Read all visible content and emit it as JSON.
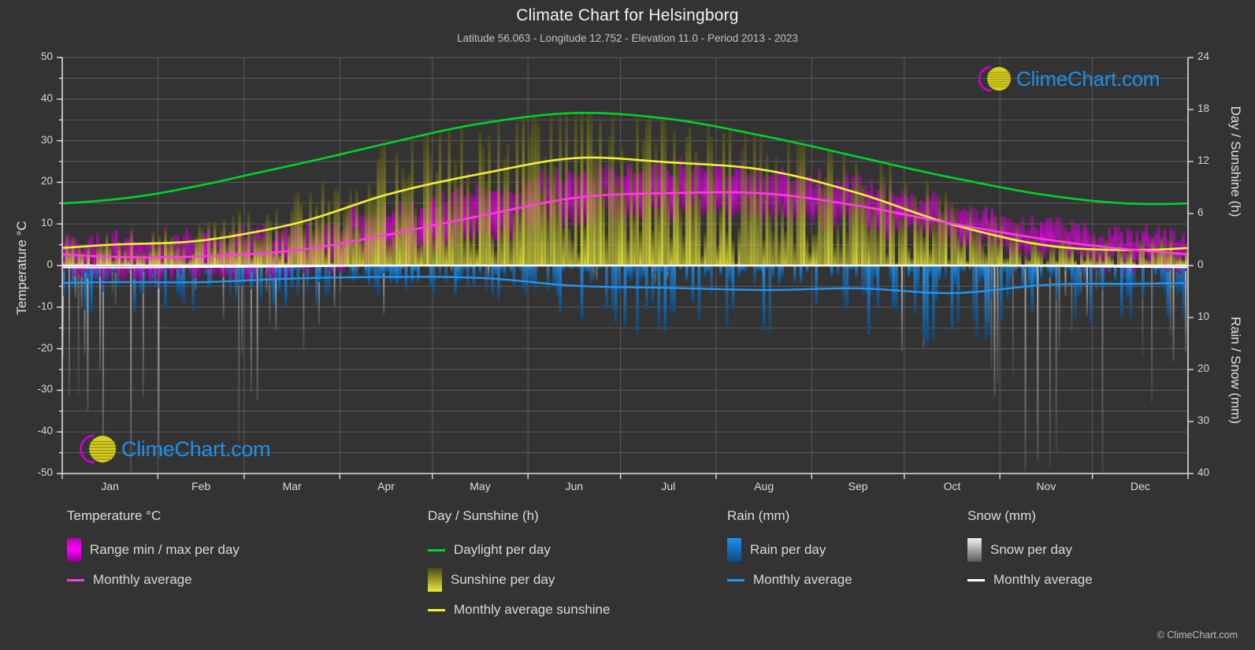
{
  "header": {
    "title": "Climate Chart for Helsingborg",
    "subtitle": "Latitude 56.063 - Longitude 12.752 - Elevation 11.0 - Period 2013 - 2023"
  },
  "branding": {
    "logo_text": "ClimeChart.com",
    "copyright": "© ClimeChart.com"
  },
  "axes": {
    "left_title": "Temperature °C",
    "right_top_title": "Day / Sunshine (h)",
    "right_bottom_title": "Rain / Snow (mm)",
    "left_ticks": [
      "50",
      "40",
      "30",
      "20",
      "10",
      "0",
      "-10",
      "-20",
      "-30",
      "-40",
      "-50"
    ],
    "right_top_ticks": [
      "24",
      "18",
      "12",
      "6",
      "0"
    ],
    "right_bottom_ticks": [
      "10",
      "20",
      "30",
      "40"
    ]
  },
  "legend": {
    "temperature": {
      "heading": "Temperature °C",
      "items": [
        {
          "label": "Range min / max per day",
          "type": "swatch",
          "color": "#ee00ee"
        },
        {
          "label": "Monthly average",
          "type": "line",
          "color": "#ff3ddd"
        }
      ]
    },
    "day_sunshine": {
      "heading": "Day / Sunshine (h)",
      "items": [
        {
          "label": "Daylight per day",
          "type": "line",
          "color": "#00d22a"
        },
        {
          "label": "Sunshine per day",
          "type": "swatch",
          "color": "#e8e830"
        },
        {
          "label": "Monthly average sunshine",
          "type": "line",
          "color": "#f0f03a"
        }
      ]
    },
    "rain": {
      "heading": "Rain (mm)",
      "items": [
        {
          "label": "Rain per day",
          "type": "swatch",
          "color": "#1e88e5"
        },
        {
          "label": "Monthly average",
          "type": "line",
          "color": "#2196f3"
        }
      ]
    },
    "snow": {
      "heading": "Snow (mm)",
      "items": [
        {
          "label": "Snow per day",
          "type": "swatch",
          "color": "#dcdcdc"
        },
        {
          "label": "Monthly average",
          "type": "line",
          "color": "#ffffff"
        }
      ]
    }
  },
  "chart_data": {
    "type": "line",
    "title": "Climate Chart for Helsingborg",
    "subtitle": "Latitude 56.063 - Longitude 12.752 - Elevation 11.0 - Period 2013 - 2023",
    "xlabel": "",
    "ylabel": "Temperature °C",
    "ylim": [
      -50,
      50
    ],
    "y2_top_label": "Day / Sunshine (h)",
    "y2_top_lim": [
      0,
      24
    ],
    "y2_bottom_label": "Rain / Snow (mm)",
    "y2_bottom_lim": [
      0,
      40
    ],
    "grid": true,
    "legend_position": "below",
    "categories": [
      "Jan",
      "Feb",
      "Mar",
      "Apr",
      "May",
      "Jun",
      "Jul",
      "Aug",
      "Sep",
      "Oct",
      "Nov",
      "Dec"
    ],
    "series": [
      {
        "name": "Daylight per day",
        "unit": "h",
        "color": "#00d22a",
        "values": [
          7.6,
          9.3,
          11.6,
          14.1,
          16.4,
          17.6,
          16.9,
          14.9,
          12.5,
          10.1,
          8.1,
          7.1
        ]
      },
      {
        "name": "Monthly average sunshine",
        "unit": "h",
        "color": "#f0f03a",
        "values": [
          2.4,
          2.9,
          4.8,
          8.2,
          10.6,
          12.4,
          11.9,
          11.0,
          8.3,
          4.7,
          2.3,
          1.8
        ]
      },
      {
        "name": "Monthly average temperature",
        "unit": "°C",
        "color": "#ff3ddd",
        "values": [
          2.1,
          2.2,
          3.6,
          7.4,
          12.0,
          16.3,
          17.4,
          17.3,
          14.3,
          10.0,
          6.2,
          3.6
        ]
      },
      {
        "name": "Monthly average rain",
        "unit": "mm",
        "color": "#2196f3",
        "values": [
          3.2,
          3.2,
          2.5,
          2.2,
          2.4,
          3.9,
          4.3,
          4.7,
          4.4,
          5.3,
          3.7,
          3.5
        ]
      },
      {
        "name": "Monthly average snow",
        "unit": "mm",
        "color": "#ffffff",
        "values": [
          0.4,
          0.3,
          0.2,
          0.0,
          0.0,
          0.0,
          0.0,
          0.0,
          0.0,
          0.0,
          0.1,
          0.3
        ]
      }
    ],
    "daily_ranges": {
      "name": "Temperature range min / max per day",
      "color": "#ee00ee",
      "monthly_min": [
        -1.2,
        -1.0,
        0.2,
        3.0,
        7.4,
        11.6,
        13.2,
        13.1,
        10.4,
        6.8,
        3.4,
        0.8
      ],
      "monthly_max": [
        5.0,
        5.3,
        7.3,
        12.0,
        16.6,
        20.8,
        21.8,
        21.6,
        18.0,
        13.1,
        8.6,
        6.1
      ]
    }
  }
}
